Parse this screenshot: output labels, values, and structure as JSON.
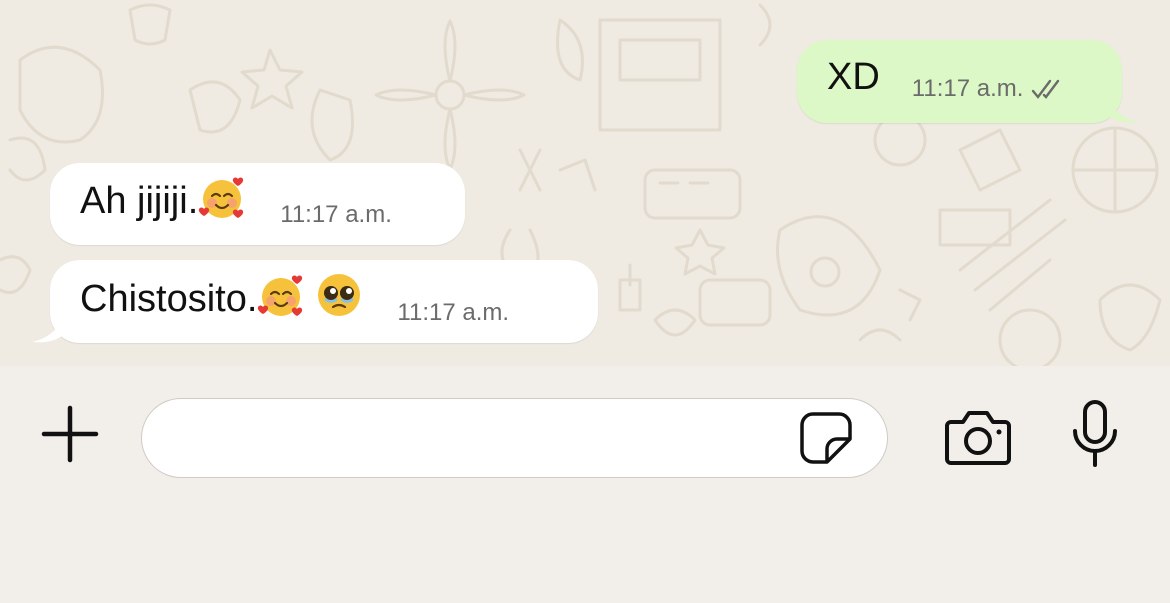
{
  "messages": [
    {
      "direction": "outgoing",
      "text": "XD",
      "time": "11:17 a.m.",
      "status": "read-double-check"
    },
    {
      "direction": "incoming",
      "text": "Ah jijiji.",
      "emojis": [
        "smiling-face-with-hearts"
      ],
      "time": "11:17 a.m."
    },
    {
      "direction": "incoming",
      "text": "Chistosito.",
      "emojis": [
        "smiling-face-with-hearts",
        "pleading-face"
      ],
      "time": "11:17 a.m."
    }
  ],
  "composer": {
    "input_value": "",
    "icons": [
      "plus-icon",
      "sticker-icon",
      "camera-icon",
      "microphone-icon"
    ]
  },
  "colors": {
    "chat_background": "#efeae2",
    "outgoing_bubble": "#dcf8c6",
    "incoming_bubble": "#ffffff",
    "composer_background": "#f2efea"
  }
}
